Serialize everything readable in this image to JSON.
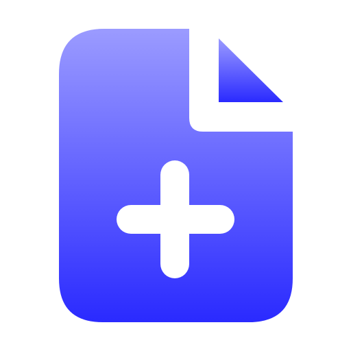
{
  "icon": {
    "name": "add-file-icon",
    "gradient_top": "#9B9BFF",
    "gradient_bottom": "#2A2AFF",
    "plus_color": "#FFFFFF",
    "background": "#FFFFFF"
  }
}
